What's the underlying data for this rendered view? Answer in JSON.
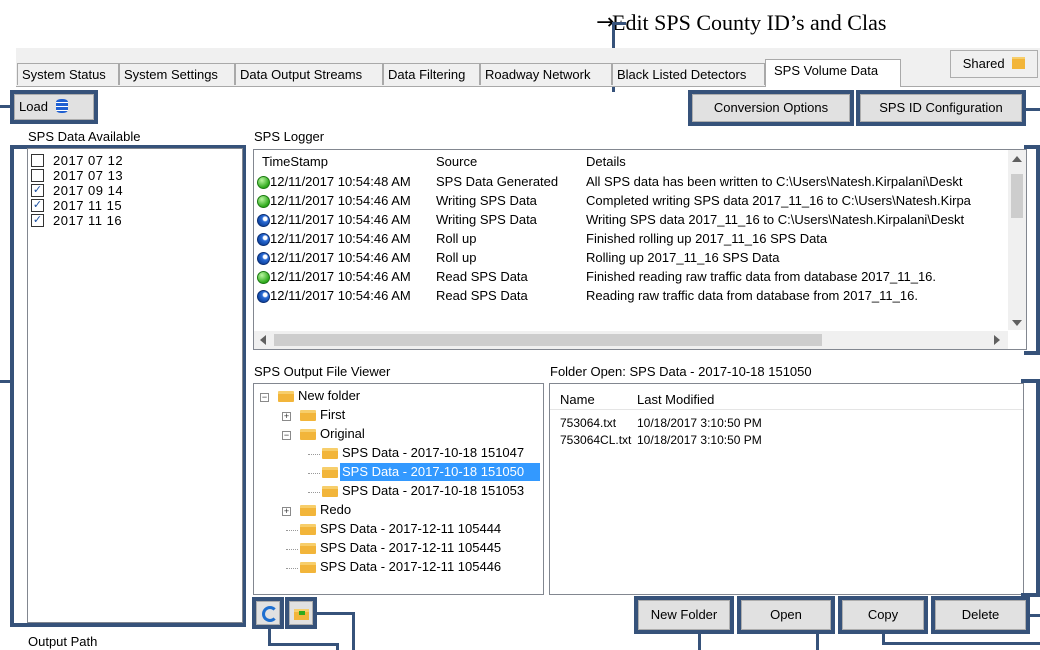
{
  "annotation": {
    "arrow": "→",
    "text": "Edit SPS County ID’s and Clas"
  },
  "tabs": [
    {
      "label": "System Status"
    },
    {
      "label": "System Settings"
    },
    {
      "label": "Data Output Streams"
    },
    {
      "label": "Data Filtering"
    },
    {
      "label": "Roadway Network"
    },
    {
      "label": "Black Listed Detectors"
    },
    {
      "label": "SPS Volume Data",
      "active": true
    }
  ],
  "shared_button": {
    "label": "Shared",
    "icon": "folder-open-icon"
  },
  "load_button": {
    "label": "Load",
    "icon": "database-icon"
  },
  "conversion_button": {
    "label": "Conversion Options"
  },
  "sps_id_button": {
    "label": "SPS ID Configuration"
  },
  "sps_data_available": {
    "label": "SPS Data Available",
    "items": [
      {
        "label": "2017 07 12",
        "checked": false
      },
      {
        "label": "2017 07 13",
        "checked": false
      },
      {
        "label": "2017 09 14",
        "checked": true
      },
      {
        "label": "2017 11 15",
        "checked": true
      },
      {
        "label": "2017 11 16",
        "checked": true
      }
    ]
  },
  "logger": {
    "label": "SPS Logger",
    "columns": [
      "TimeStamp",
      "Source",
      "Details"
    ],
    "rows": [
      {
        "icon": "green",
        "time": "12/11/2017 10:54:48 AM",
        "source": "SPS Data Generated",
        "details": "All SPS data has been written to C:\\Users\\Natesh.Kirpalani\\Deskt"
      },
      {
        "icon": "green",
        "time": "12/11/2017 10:54:46 AM",
        "source": "Writing SPS Data",
        "details": "Completed writing SPS data 2017_11_16 to C:\\Users\\Natesh.Kirpa"
      },
      {
        "icon": "blue",
        "time": "12/11/2017 10:54:46 AM",
        "source": "Writing SPS Data",
        "details": "Writing SPS data 2017_11_16 to C:\\Users\\Natesh.Kirpalani\\Deskt"
      },
      {
        "icon": "blue",
        "time": "12/11/2017 10:54:46 AM",
        "source": "Roll up",
        "details": "Finished rolling up 2017_11_16 SPS Data"
      },
      {
        "icon": "blue",
        "time": "12/11/2017 10:54:46 AM",
        "source": "Roll up",
        "details": "Rolling up 2017_11_16 SPS Data"
      },
      {
        "icon": "green",
        "time": "12/11/2017 10:54:46 AM",
        "source": "Read SPS Data",
        "details": "Finished reading raw traffic data from database 2017_11_16."
      },
      {
        "icon": "blue",
        "time": "12/11/2017 10:54:46 AM",
        "source": "Read SPS Data",
        "details": "Reading raw traffic data from database from 2017_11_16."
      }
    ]
  },
  "viewer": {
    "label": "SPS Output File Viewer",
    "tree": [
      {
        "label": "New folder",
        "toggle": "−"
      },
      {
        "label": "First",
        "toggle": "+"
      },
      {
        "label": "Original",
        "toggle": "−"
      },
      {
        "label": "SPS Data - 2017-10-18 151047"
      },
      {
        "label": "SPS Data - 2017-10-18 151050",
        "selected": true
      },
      {
        "label": "SPS Data - 2017-10-18 151053"
      },
      {
        "label": "Redo",
        "toggle": "+"
      },
      {
        "label": "SPS Data - 2017-12-11 105444"
      },
      {
        "label": "SPS Data - 2017-12-11 105445"
      },
      {
        "label": "SPS Data - 2017-12-11 105446"
      }
    ]
  },
  "folder_open": {
    "label": "Folder Open: SPS Data - 2017-10-18 151050",
    "columns": [
      "Name",
      "Last Modified"
    ],
    "files": [
      {
        "name": "753064.txt",
        "modified": "10/18/2017 3:10:50 PM"
      },
      {
        "name": "753064CL.txt",
        "modified": "10/18/2017 3:10:50 PM"
      }
    ]
  },
  "actions": {
    "refresh_icon": "refresh-icon",
    "export_icon": "folder-export-icon",
    "new_folder": "New Folder",
    "open": "Open",
    "copy": "Copy",
    "delete": "Delete"
  },
  "output_path": {
    "label": "Output Path"
  },
  "colors": {
    "highlight": "#36527a",
    "selection": "#3399ff",
    "folder": "#f2b53a"
  }
}
